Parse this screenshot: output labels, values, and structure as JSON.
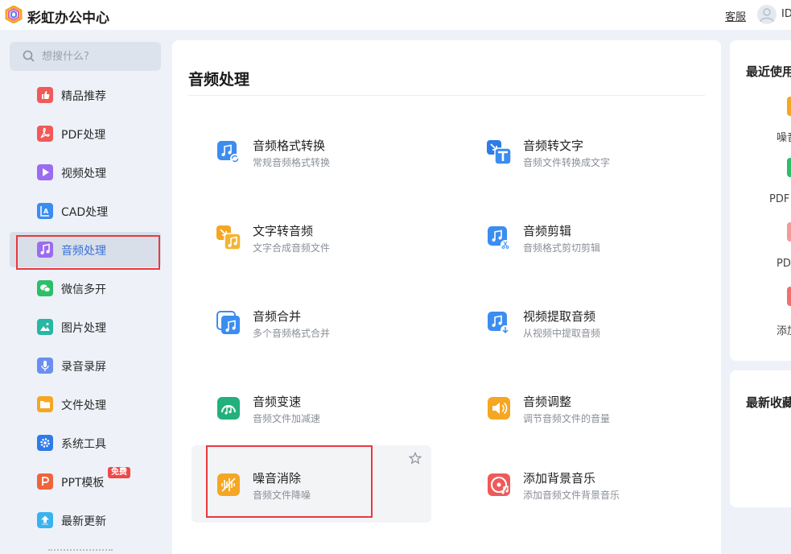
{
  "app": {
    "title": "彩虹办公中心"
  },
  "header": {
    "service": "客服",
    "user_id": "ID"
  },
  "search": {
    "placeholder": "想搜什么?"
  },
  "sidebar": {
    "items": [
      {
        "label": "精品推荐",
        "icon": "thumbs-up-icon",
        "color": "#f05a5a"
      },
      {
        "label": "PDF处理",
        "icon": "pdf-icon",
        "color": "#f05a5a"
      },
      {
        "label": "视频处理",
        "icon": "video-play-icon",
        "color": "#9b6cf0"
      },
      {
        "label": "CAD处理",
        "icon": "cad-icon",
        "color": "#3b8df0"
      },
      {
        "label": "音频处理",
        "icon": "music-note-icon",
        "color": "#9b6cf0"
      },
      {
        "label": "微信多开",
        "icon": "wechat-icon",
        "color": "#2cbf6a"
      },
      {
        "label": "图片处理",
        "icon": "image-icon",
        "color": "#28b7a2"
      },
      {
        "label": "录音录屏",
        "icon": "microphone-icon",
        "color": "#6b8ff0"
      },
      {
        "label": "文件处理",
        "icon": "folder-icon",
        "color": "#f5a623"
      },
      {
        "label": "系统工具",
        "icon": "gear-icon",
        "color": "#2f7be8"
      },
      {
        "label": "PPT模板",
        "icon": "ppt-icon",
        "color": "#f0643c",
        "badge": "免费"
      },
      {
        "label": "最新更新",
        "icon": "upload-arrow-icon",
        "color": "#39b3f0"
      }
    ]
  },
  "main": {
    "title": "音频处理",
    "tools": [
      {
        "name": "音频格式转换",
        "desc": "常规音频格式转换",
        "icon": "audio-convert-icon"
      },
      {
        "name": "音频转文字",
        "desc": "音频文件转换成文字",
        "icon": "audio-to-text-icon"
      },
      {
        "name": "文字转音频",
        "desc": "文字合成音频文件",
        "icon": "text-to-audio-icon"
      },
      {
        "name": "音频剪辑",
        "desc": "音频格式剪切剪辑",
        "icon": "audio-cut-icon"
      },
      {
        "name": "音频合并",
        "desc": "多个音频格式合并",
        "icon": "audio-merge-icon"
      },
      {
        "name": "视频提取音频",
        "desc": "从视频中提取音频",
        "icon": "video-extract-audio-icon"
      },
      {
        "name": "音频变速",
        "desc": "音频文件加减速",
        "icon": "audio-speed-icon"
      },
      {
        "name": "音频调整",
        "desc": "调节音频文件的音量",
        "icon": "volume-icon"
      },
      {
        "name": "噪音消除",
        "desc": "音频文件降噪",
        "icon": "noise-reduction-icon"
      },
      {
        "name": "添加背景音乐",
        "desc": "添加音频文件背景音乐",
        "icon": "background-music-icon"
      }
    ]
  },
  "recent": {
    "title": "最近使用",
    "items": [
      {
        "label": "噪音",
        "color": "#f5a623"
      },
      {
        "label": "PDF",
        "color": "#2cbf6a"
      },
      {
        "label": "PD",
        "color": "#f39a9a"
      },
      {
        "label": "添加",
        "color": "#f07070"
      }
    ]
  },
  "favorites": {
    "title": "最新收藏"
  }
}
